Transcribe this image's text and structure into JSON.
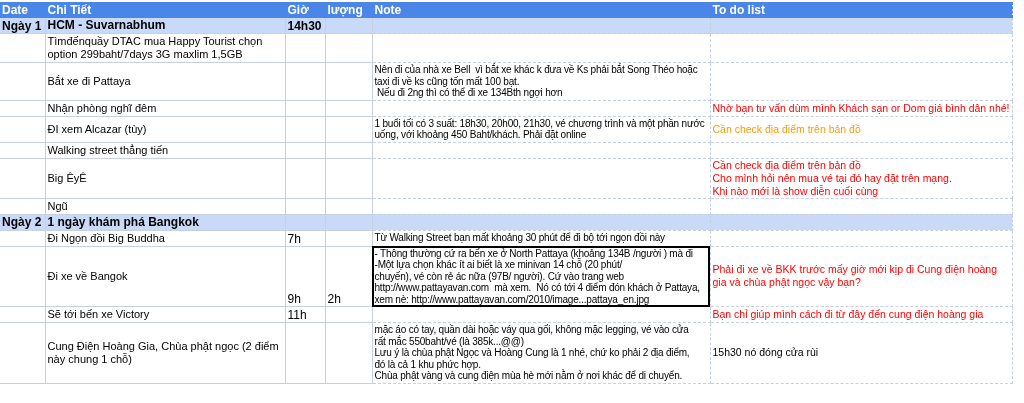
{
  "columns": [
    "Date",
    "Chi Tiết",
    "Giờ",
    "lượng",
    "Note",
    "To do list"
  ],
  "rows": [
    {
      "kind": "day",
      "date": "Ngày 1",
      "detail": "HCM - Suvarnabhum",
      "time": "14h30",
      "selected": false
    },
    {
      "kind": "item",
      "detail": "Tìmđếnquầy DTAC mua Happy Tourist chọn option 299baht/7days 3G maxlim 1,5GB",
      "selected": false
    },
    {
      "kind": "item",
      "detail": "Bắt xe đi Pattaya",
      "note": "Nên đi của nhà xe Bell  vì bắt xe khác k đưa về Ks phải bắt Song Théo hoặc taxi đi về ks cũng tốn mất 100 bạt.\n Nếu đi 2ng thì có thể đi xe 134Bth ngợi hơn",
      "selected": false
    },
    {
      "kind": "item",
      "detail": "Nhận phòng nghĩ đêm",
      "todo": "Nhờ bạn tư vấn dùm mình Khách sạn or Dom giá bình dân nhé!",
      "color": "#ff0000",
      "selected": false
    },
    {
      "kind": "item",
      "detail": "ĐI xem Alcazar (tùy)",
      "note": "1 buổi tối có 3 suất: 18h30, 20h00, 21h30, vé chương trình và một phần nước uống, với khoảng 450 Baht/khách. Phải đặt online",
      "todo": "Cần check địa điểm trên bản đồ",
      "color": "#ff9900",
      "selected": false
    },
    {
      "kind": "item",
      "detail": "Walking street thẳng tiến",
      "selected": false
    },
    {
      "kind": "item",
      "detail": "Big ÊyÊ",
      "todo": "Cần check địa điểm trên bản đồ\nCho mình hỏi nên mua vé tại đó hay đặt trên mạng.\nKhi nào mới là show diễn cuối cùng",
      "color": "#ff0000",
      "selected": false
    },
    {
      "kind": "item",
      "detail": "Ngũ",
      "selected": false
    },
    {
      "kind": "day",
      "date": "Ngày 2",
      "detail": "1 ngày khám phá Bangkok",
      "selected": false
    },
    {
      "kind": "item",
      "detail": "Đi Ngọn đồi Big Buddha",
      "time": "7h",
      "note": "Từ Walking Street bạn mất khoảng 30 phút để đi bộ tới ngọn đồi này",
      "selected": false
    },
    {
      "kind": "item",
      "detail": "Đi xe về Bangok",
      "time": "9h",
      "duration": "2h",
      "note": "- Thông thường cứ ra bến xe ở North Pattaya (khoảng 134B /người ) mà đi\n-Một lựa chọn khác ít ai biết là xe minivan 14 chỗ (20 phút/\nchuyến), vé còn rẻ ác nữa (97B/ người). Cứ vào trang web\nhttp://www.pattayavan.com  mà xem.  Nó có tới 4 điểm đón khách ở Pattaya,\nxem nè: http://www.pattayavan.com/2010/image...pattaya_en.jpg",
      "todo": "Phải đi xe về BKK trước mấy giờ mới kịp đi Cung điện hoàng gia và chùa phật ngọc vậy bạn?",
      "color": "#ff0000",
      "selected": true
    },
    {
      "kind": "item",
      "detail": "Sẽ tới bến xe Victory",
      "time": "11h",
      "todo": "Bạn chỉ giúp mình cách đi từ đây đến cung điện hoàng gia",
      "color": "#ff0000",
      "selected": false
    },
    {
      "kind": "item",
      "detail": "Cung Điện Hoàng Gia, Chùa phật ngọc (2 điểm này chung 1 chỗ)",
      "note": "mặc áo có tay, quần dài hoặc váy qua gối, không mặc legging, vé vào cửa\nrất mắc 550baht/vé (là 385k...@@)\nLưu ý là chùa phật Ngọc và Hoàng Cung là 1 nhé, chứ ko phải 2 địa điểm,\nđó là cả 1 khu phức hợp.\nChùa phật vàng và cung điện mùa hè mới nằm ở nơi khác để di chuyển.",
      "todo": "15h30 nó đóng cửa rùi",
      "selected": false
    }
  ]
}
